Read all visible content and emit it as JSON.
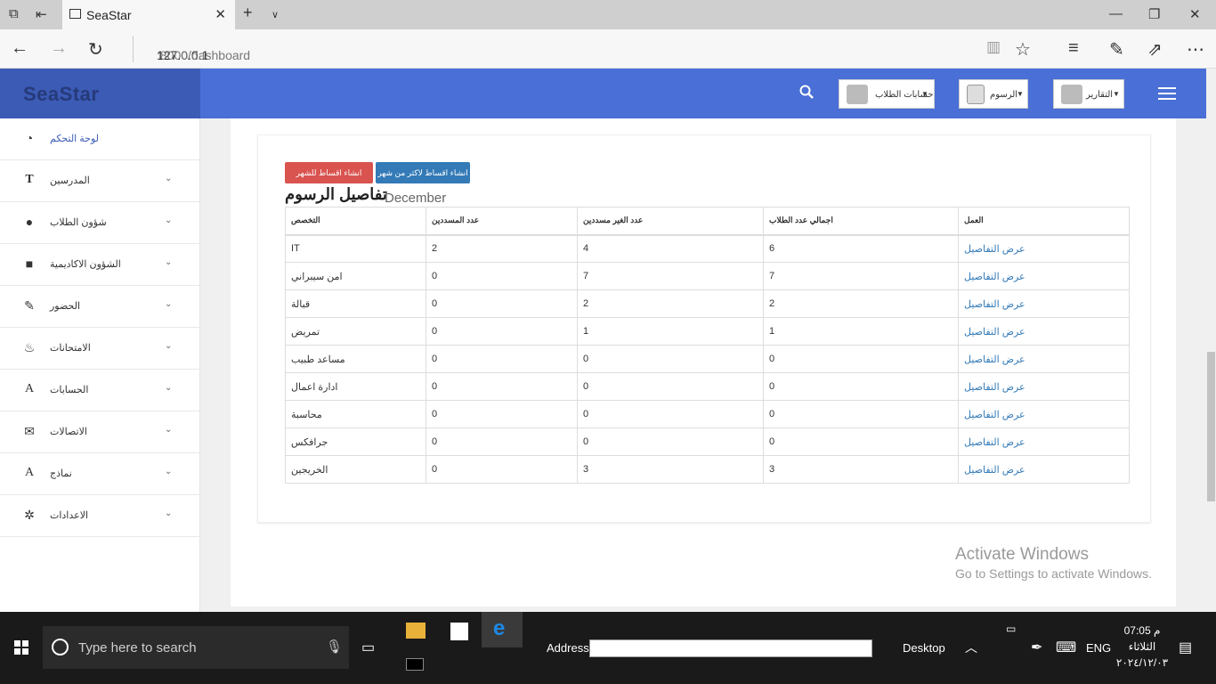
{
  "browser": {
    "tab_title": "SeaStar",
    "url_host": "127.0.0.1",
    "url_path": ":8000/dashboard"
  },
  "app": {
    "brand": "SeaStar",
    "sidebar": [
      {
        "label": "لوحة التحكم",
        "icon": "dashboard-icon",
        "active": true
      },
      {
        "label": "المدرسين",
        "icon": "text-icon"
      },
      {
        "label": "شؤون الطلاب",
        "icon": "user-icon"
      },
      {
        "label": "الشؤون الاكاديمية",
        "icon": "book-icon"
      },
      {
        "label": "الحضور",
        "icon": "pencil-icon"
      },
      {
        "label": "الامتحانات",
        "icon": "fire-icon"
      },
      {
        "label": "الحسابات",
        "icon": "font-icon"
      },
      {
        "label": "الاتصالات",
        "icon": "envelope-icon"
      },
      {
        "label": "نماذج",
        "icon": "font-icon"
      },
      {
        "label": "الاعدادات",
        "icon": "gear-icon"
      }
    ],
    "topbar": {
      "student_accounts": "حسابات الطلاب",
      "fees": "الرسوم",
      "reports": "التقارير"
    }
  },
  "main": {
    "btn_current_month": "انشاء اقساط للشهر الحالي",
    "btn_more_than_month": "انشاء اقساط لاكثر من شهر",
    "heading": "تفاصيل الرسوم",
    "month": "December",
    "table": {
      "headers": [
        "التخصص",
        "عدد المسددين",
        "عدد الغير مسددين",
        "اجمالي عدد الطلاب",
        "العمل"
      ],
      "rows": [
        [
          "IT",
          "2",
          "4",
          "6",
          "عرض التفاصيل"
        ],
        [
          "امن سيبراني",
          "0",
          "7",
          "7",
          "عرض التفاصيل"
        ],
        [
          "قبالة",
          "0",
          "2",
          "2",
          "عرض التفاصيل"
        ],
        [
          "تمريض",
          "0",
          "1",
          "1",
          "عرض التفاصيل"
        ],
        [
          "مساعد طبيب",
          "0",
          "0",
          "0",
          "عرض التفاصيل"
        ],
        [
          "ادارة اعمال",
          "0",
          "0",
          "0",
          "عرض التفاصيل"
        ],
        [
          "محاسبة",
          "0",
          "0",
          "0",
          "عرض التفاصيل"
        ],
        [
          "جرافكس",
          "0",
          "0",
          "0",
          "عرض التفاصيل"
        ],
        [
          "الخريجين",
          "0",
          "3",
          "3",
          "عرض التفاصيل"
        ]
      ]
    }
  },
  "watermark": {
    "line1": "Activate Windows",
    "line2": "Go to Settings to activate Windows."
  },
  "taskbar": {
    "search_placeholder": "Type here to search",
    "address_label": "Address",
    "desktop_label": "Desktop",
    "lang": "ENG",
    "time": "07:05 م",
    "day": "الثلاثاء",
    "date": "٢٠٢٤/١٢/٠٣"
  }
}
